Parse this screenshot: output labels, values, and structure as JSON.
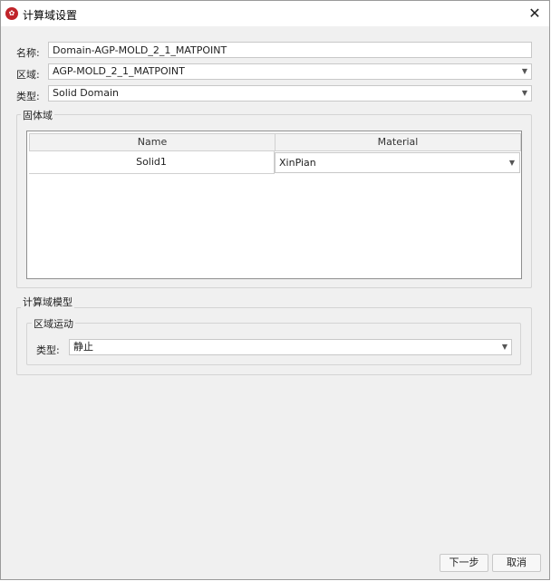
{
  "window": {
    "title": "计算域设置",
    "icon": "app-logo-icon",
    "close_glyph": "✕"
  },
  "form": {
    "name_label": "名称:",
    "name_value": "Domain-AGP-MOLD_2_1_MATPOINT",
    "region_label": "区域:",
    "region_value": "AGP-MOLD_2_1_MATPOINT",
    "type_label": "类型:",
    "type_value": "Solid Domain"
  },
  "solid_group": {
    "title": "固体域",
    "table": {
      "columns": [
        "Name",
        "Material"
      ],
      "rows": [
        {
          "name": "Solid1",
          "material": "XinPian"
        }
      ]
    }
  },
  "model_group": {
    "title": "计算域模型",
    "motion_group": {
      "title": "区域运动",
      "type_label": "类型:",
      "type_value": "静止"
    }
  },
  "buttons": {
    "next": "下一步",
    "cancel": "取消"
  },
  "icons": {
    "dropdown": "▼"
  }
}
